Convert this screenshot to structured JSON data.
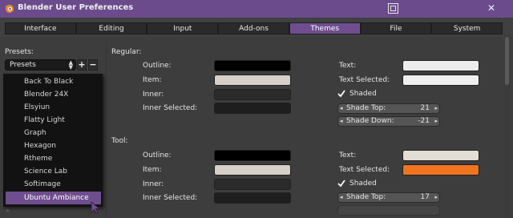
{
  "window": {
    "title": "Blender User Preferences",
    "close_glyph": "✕"
  },
  "tabs": [
    {
      "label": "Interface",
      "active": false
    },
    {
      "label": "Editing",
      "active": false
    },
    {
      "label": "Input",
      "active": false
    },
    {
      "label": "Add-ons",
      "active": false
    },
    {
      "label": "Themes",
      "active": true
    },
    {
      "label": "File",
      "active": false
    },
    {
      "label": "System",
      "active": false
    }
  ],
  "presets": {
    "heading": "Presets:",
    "selected": "Presets",
    "add_glyph": "+",
    "remove_glyph": "−",
    "items": [
      "Back To Black",
      "Blender 24X",
      "Elsyiun",
      "Flatty Light",
      "Graph",
      "Hexagon",
      "Rtheme",
      "Science Lab",
      "Softimage",
      "Ubuntu Ambiance"
    ],
    "selected_item": "Ubuntu Ambiance"
  },
  "regular": {
    "heading": "Regular:",
    "outline_label": "Outline:",
    "item_label": "Item:",
    "inner_label": "Inner:",
    "inner_selected_label": "Inner Selected:",
    "text_label": "Text:",
    "text_selected_label": "Text Selected:",
    "shaded_label": "Shaded",
    "shade_top_label": "Shade Top:",
    "shade_top_value": "21",
    "shade_down_label": "Shade Down:",
    "shade_down_value": "-21",
    "colors": {
      "outline": "#000000",
      "item": "#d6d0c8",
      "inner": "#2b2b2b",
      "inner_selected": "#1e1e1e",
      "text": "#ececec",
      "text_selected": "#efefef"
    }
  },
  "tool": {
    "heading": "Tool:",
    "outline_label": "Outline:",
    "item_label": "Item:",
    "inner_label": "Inner:",
    "inner_selected_label": "Inner Selected:",
    "text_label": "Text:",
    "text_selected_label": "Text Selected:",
    "shaded_label": "Shaded",
    "shade_top_label": "Shade Top:",
    "shade_top_value": "17",
    "colors": {
      "outline": "#000000",
      "item": "#d6d0c8",
      "inner": "#2b2b2b",
      "inner_selected": "#1e1e1e",
      "text": "#e2ded6",
      "text_selected": "#f07420"
    }
  },
  "colors": {
    "title_bar": "#6b4b8c",
    "active_tab": "#6f4e8f",
    "background": "#3d3d3d"
  }
}
